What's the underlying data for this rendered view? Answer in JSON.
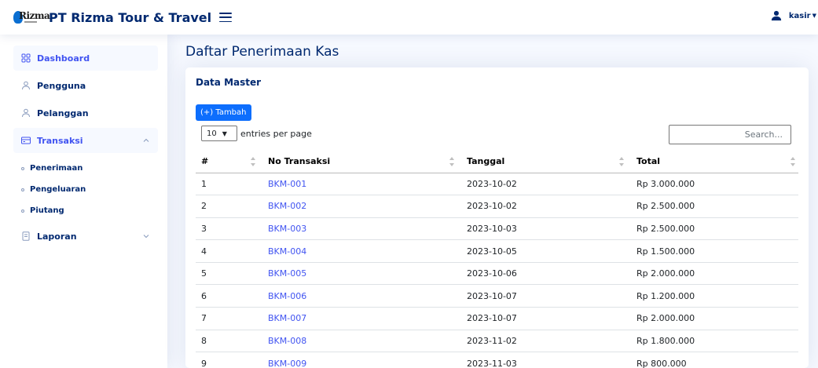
{
  "header": {
    "logo_text": "Rizma",
    "brand": "PT Rizma Tour & Travel",
    "user_name": "kasir"
  },
  "sidebar": {
    "items": [
      {
        "label": "Dashboard",
        "icon": "grid-icon",
        "active": true
      },
      {
        "label": "Pengguna",
        "icon": "person-icon"
      },
      {
        "label": "Pelanggan",
        "icon": "person-icon"
      },
      {
        "label": "Transaksi",
        "icon": "card-icon",
        "expanded": true
      },
      {
        "label": "Laporan",
        "icon": "document-icon",
        "expanded": false
      }
    ],
    "sub_items": [
      {
        "label": "Penerimaan"
      },
      {
        "label": "Pengeluaran"
      },
      {
        "label": "Piutang"
      }
    ]
  },
  "main": {
    "page_title": "Daftar Penerimaan Kas",
    "card_title": "Data Master",
    "add_button": "(+) Tambah",
    "entries_value": "10",
    "entries_label": "entries per page",
    "search_placeholder": "Search...",
    "columns": [
      "#",
      "No Transaksi",
      "Tanggal",
      "Total"
    ],
    "rows": [
      {
        "no": "1",
        "trx": "BKM-001",
        "date": "2023-10-02",
        "total": "Rp 3.000.000"
      },
      {
        "no": "2",
        "trx": "BKM-002",
        "date": "2023-10-02",
        "total": "Rp 2.500.000"
      },
      {
        "no": "3",
        "trx": "BKM-003",
        "date": "2023-10-03",
        "total": "Rp 2.500.000"
      },
      {
        "no": "4",
        "trx": "BKM-004",
        "date": "2023-10-05",
        "total": "Rp 1.500.000"
      },
      {
        "no": "5",
        "trx": "BKM-005",
        "date": "2023-10-06",
        "total": "Rp 2.000.000"
      },
      {
        "no": "6",
        "trx": "BKM-006",
        "date": "2023-10-07",
        "total": "Rp 1.200.000"
      },
      {
        "no": "7",
        "trx": "BKM-007",
        "date": "2023-10-07",
        "total": "Rp 2.000.000"
      },
      {
        "no": "8",
        "trx": "BKM-008",
        "date": "2023-11-02",
        "total": "Rp 1.800.000"
      },
      {
        "no": "9",
        "trx": "BKM-009",
        "date": "2023-11-03",
        "total": "Rp 800.000"
      }
    ]
  },
  "colors": {
    "accent": "#4154f1",
    "primary_button": "#0d6efd",
    "text": "#012970"
  }
}
